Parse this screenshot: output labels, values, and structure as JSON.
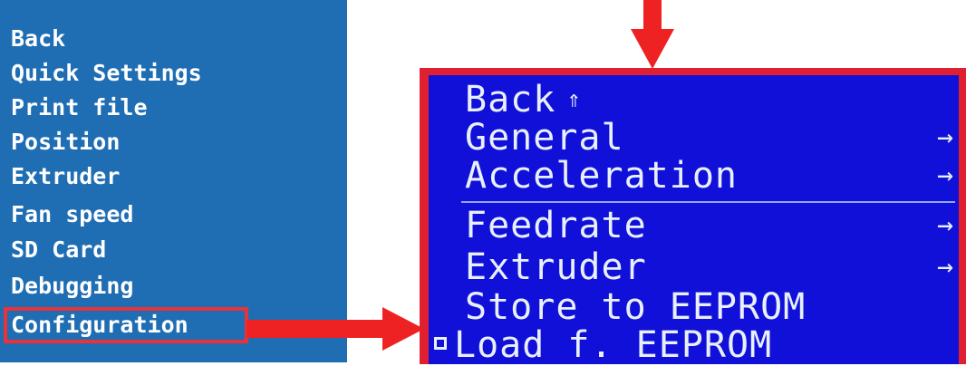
{
  "left_menu": {
    "items": [
      "Back",
      "Quick Settings",
      "Print file",
      "Position",
      "Extruder",
      "Fan speed",
      "SD Card",
      "Debugging",
      "Configuration"
    ],
    "highlighted": "Configuration"
  },
  "lcd_menu": {
    "items": [
      {
        "label": "Back",
        "icon": "up-arrow-icon"
      },
      {
        "label": "General",
        "icon": "right-arrow-icon"
      },
      {
        "label": "Acceleration",
        "icon": "right-arrow-icon"
      },
      {
        "label": "Feedrate",
        "icon": "right-arrow-icon"
      },
      {
        "label": "Extruder",
        "icon": "right-arrow-icon"
      },
      {
        "label": "Store to EEPROM",
        "icon": ""
      },
      {
        "label": "Load f. EEPROM",
        "icon": ""
      }
    ],
    "selected": "Load f. EEPROM"
  },
  "colors": {
    "left_panel_bg": "#1f6db3",
    "lcd_bg": "#1010d8",
    "highlight": "#e8333a"
  }
}
